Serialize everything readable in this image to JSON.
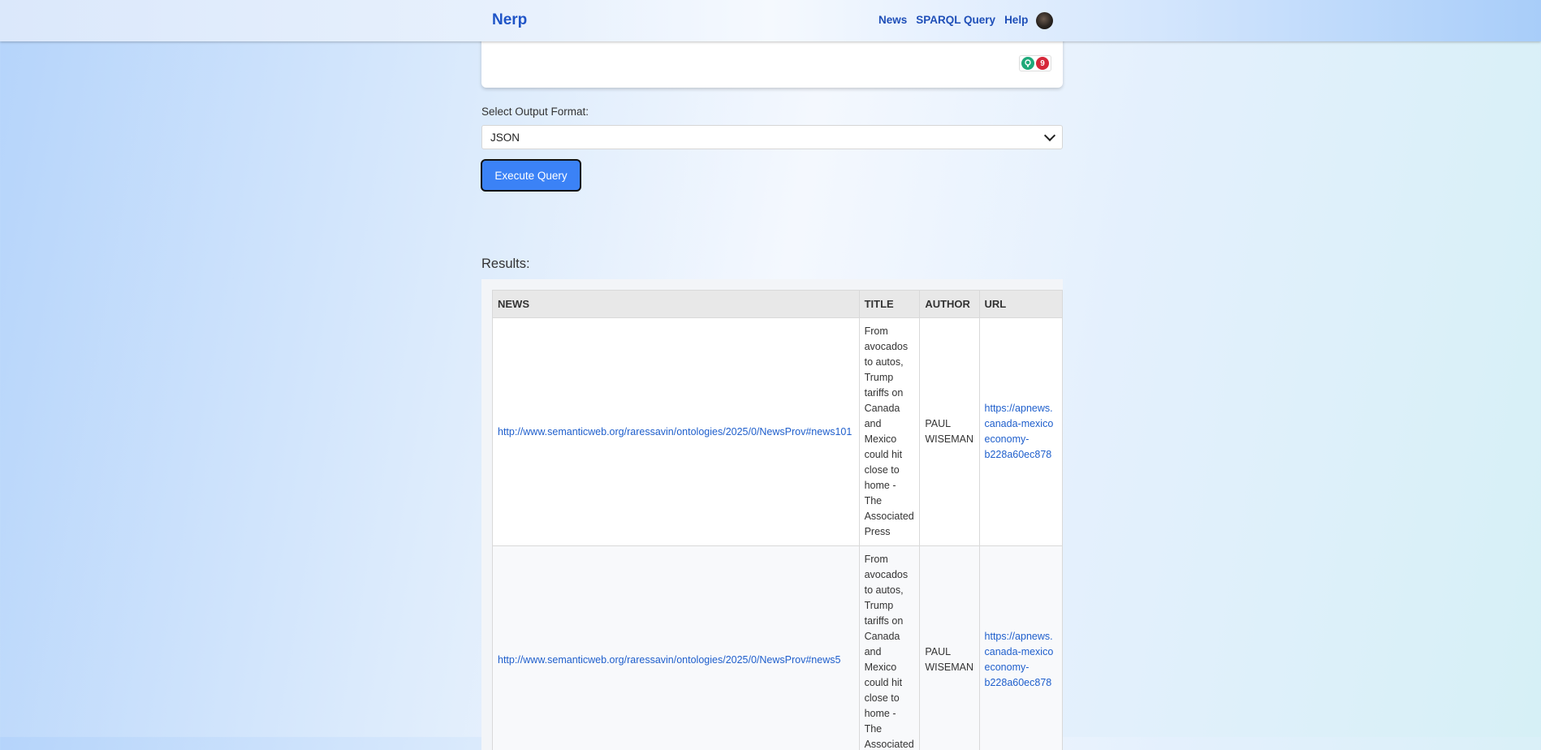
{
  "nav": {
    "brand": "Nerp",
    "links": [
      "News",
      "SPARQL Query",
      "Help"
    ],
    "avatar": "user-avatar"
  },
  "editor": {
    "extension_badge": "9"
  },
  "form": {
    "format_label": "Select Output Format:",
    "format_selected": "JSON",
    "execute_label": "Execute Query"
  },
  "results": {
    "title": "Results:",
    "headers": [
      "NEWS",
      "TITLE",
      "AUTHOR",
      "URL"
    ],
    "rows": [
      {
        "news": "http://www.semanticweb.org/raressavin/ontologies/2025/0/NewsProv#news101",
        "title": "From avocados to autos, Trump tariffs on Canada and Mexico could hit close to home - The Associated Press",
        "author": "PAUL WISEMAN",
        "url_lines": [
          "https://apnews.",
          "canada-mexico",
          "economy-",
          "b228a60ec878"
        ]
      },
      {
        "news": "http://www.semanticweb.org/raressavin/ontologies/2025/0/NewsProv#news5",
        "title": "From avocados to autos, Trump tariffs on Canada and Mexico could hit close to home - The Associated Press",
        "author": "PAUL WISEMAN",
        "url_lines": [
          "https://apnews.",
          "canada-mexico",
          "economy-",
          "b228a60ec878"
        ]
      }
    ]
  },
  "colors": {
    "brand": "#1f54c7",
    "button": "#3b82f6",
    "link": "#1f5fcc"
  }
}
